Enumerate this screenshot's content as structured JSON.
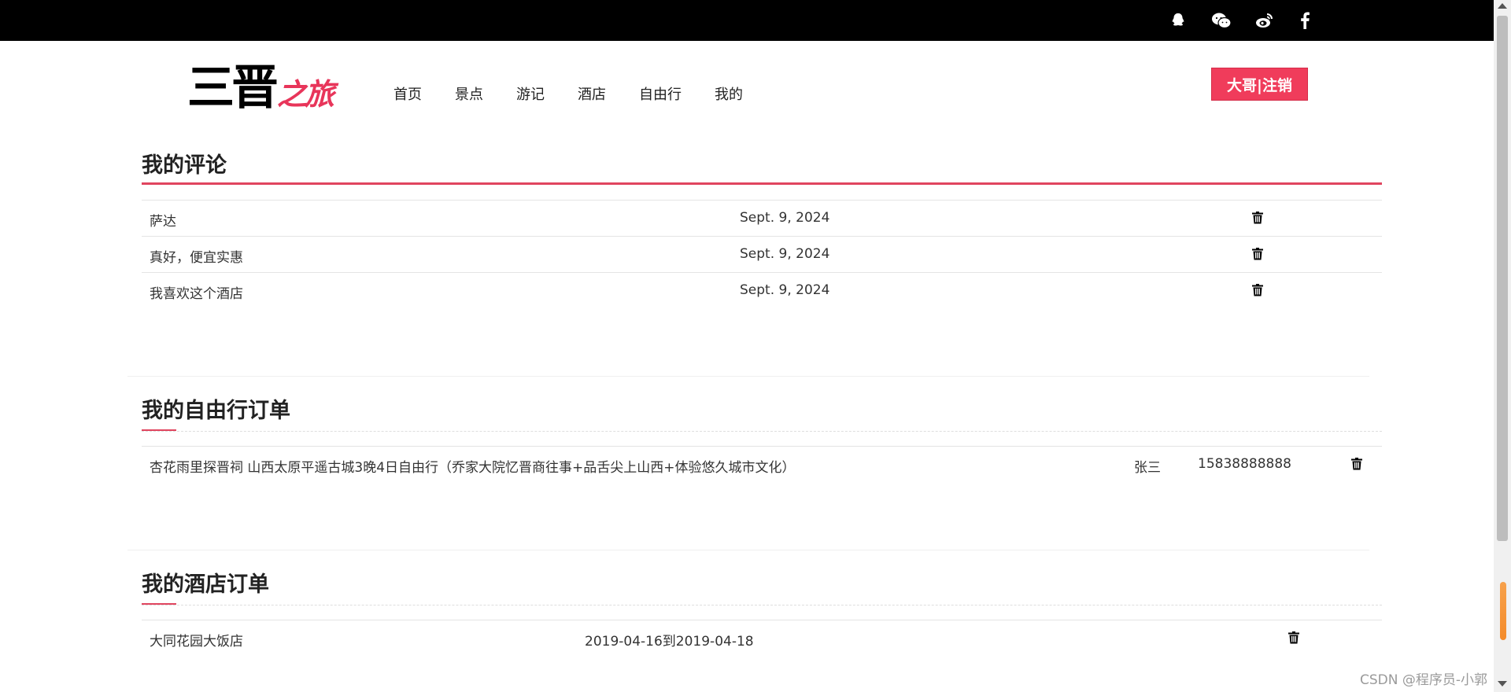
{
  "header": {
    "logo_main": "三晋",
    "logo_sub": "之旅",
    "nav": [
      "首页",
      "景点",
      "游记",
      "酒店",
      "自由行",
      "我的"
    ],
    "logout_label": "大哥|注销"
  },
  "social_icons": [
    "qq-icon",
    "wechat-icon",
    "weibo-icon",
    "facebook-icon"
  ],
  "comments": {
    "title": "我的评论",
    "rows": [
      {
        "text": "萨达",
        "date": "Sept. 9, 2024"
      },
      {
        "text": "真好，便宜实惠",
        "date": "Sept. 9, 2024"
      },
      {
        "text": "我喜欢这个酒店",
        "date": "Sept. 9, 2024"
      }
    ]
  },
  "trip_orders": {
    "title": "我的自由行订单",
    "rows": [
      {
        "name": "杏花雨里探晋祠 山西太原平遥古城3晚4日自由行（乔家大院忆晋商往事+品舌尖上山西+体验悠久城市文化）",
        "person": "张三",
        "phone": "15838888888"
      }
    ]
  },
  "hotel_orders": {
    "title": "我的酒店订单",
    "rows": [
      {
        "name": "大同花园大饭店",
        "dates": "2019-04-16到2019-04-18"
      }
    ]
  },
  "watermark": "CSDN @程序员-小郭",
  "colors": {
    "accent": "#f03c5b",
    "topbar": "#000000"
  }
}
